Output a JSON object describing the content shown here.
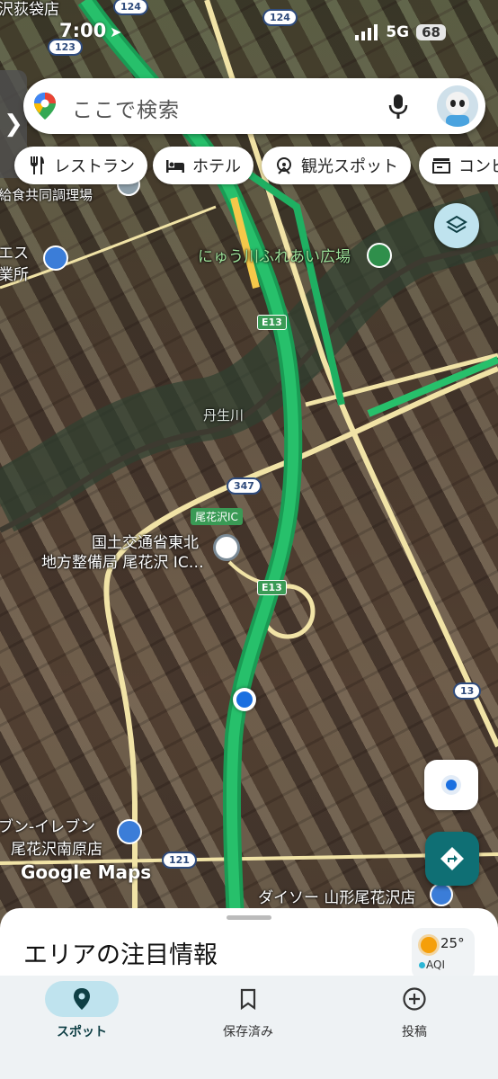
{
  "status_bar": {
    "time": "7:00",
    "network": "5G",
    "battery": "68"
  },
  "search": {
    "placeholder": "ここで検索"
  },
  "chips": [
    {
      "label": "レストラン",
      "icon": "restaurant-icon"
    },
    {
      "label": "ホテル",
      "icon": "bed-icon"
    },
    {
      "label": "観光スポット",
      "icon": "attraction-icon"
    },
    {
      "label": "コンビ",
      "icon": "store-icon"
    }
  ],
  "map": {
    "labels": {
      "top_left": "沢荻袋店",
      "school_lunch": "給食共同調理場",
      "es": "エス",
      "business": "業所",
      "park": "にゅう川ふれあい広場",
      "river": "丹生川",
      "ic": "尾花沢IC",
      "office_line1": "国土交通省東北",
      "office_line2": "地方整備局 尾花沢 IC…",
      "seven_line1": "ブン-イレブン",
      "seven_line2": "尾花沢南原店",
      "daiso": "ダイソー 山形尾花沢店"
    },
    "route_shields": {
      "r124a": "124",
      "r124b": "124",
      "r123": "123",
      "r347": "347",
      "r121": "121",
      "r13": "13",
      "e13a": "E13",
      "e13b": "E13"
    },
    "google_maps": "Google Maps"
  },
  "sheet": {
    "title": "エリアの注目情報",
    "temperature": "25°",
    "aqi": "AQI"
  },
  "nav": [
    {
      "label": "スポット",
      "icon": "pin-icon",
      "active": true
    },
    {
      "label": "保存済み",
      "icon": "bookmark-icon",
      "active": false
    },
    {
      "label": "投稿",
      "icon": "add-circle-icon",
      "active": false
    }
  ]
}
